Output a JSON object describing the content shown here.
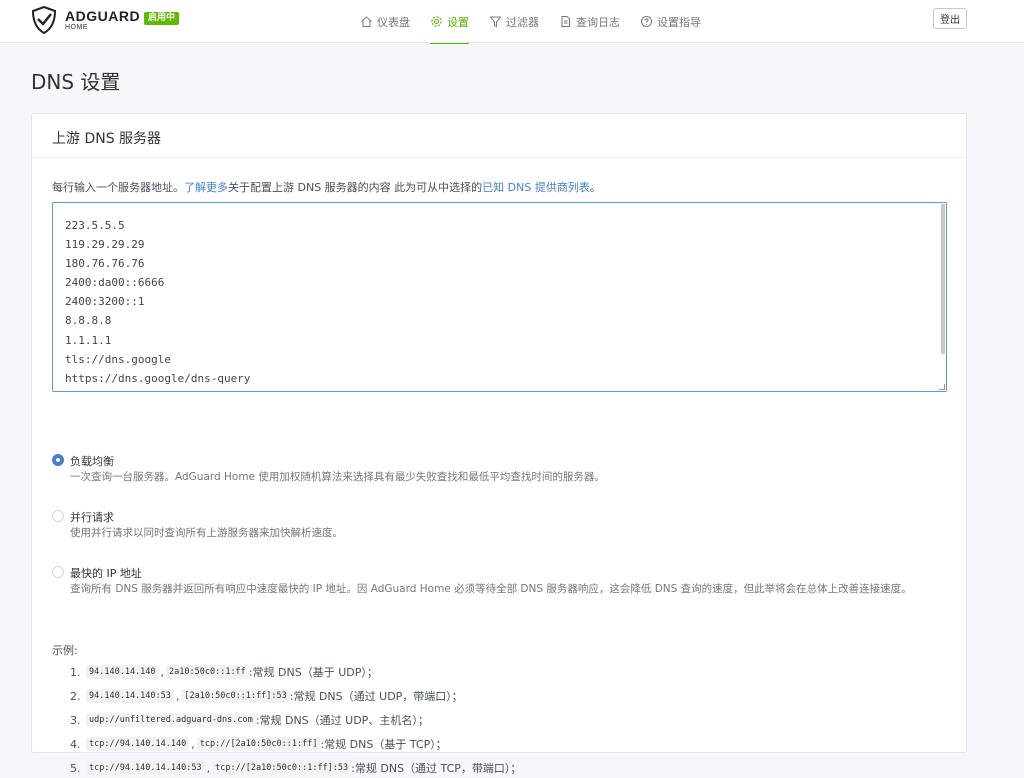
{
  "header": {
    "logo_main": "ADGUARD",
    "logo_sub": "HOME",
    "status_badge": "启用中",
    "nav": [
      {
        "label": "仪表盘",
        "icon": "home-icon"
      },
      {
        "label": "设置",
        "icon": "gear-icon",
        "active": true
      },
      {
        "label": "过滤器",
        "icon": "filter-icon"
      },
      {
        "label": "查询日志",
        "icon": "document-icon"
      },
      {
        "label": "设置指导",
        "icon": "help-circle-icon"
      }
    ],
    "logout_label": "登出",
    "accent_color": "#5eba00"
  },
  "page": {
    "title": "DNS 设置"
  },
  "upstream": {
    "card_title": "上游 DNS 服务器",
    "desc_prefix": "每行输入一个服务器地址。",
    "desc_link1": "了解更多",
    "desc_middle": "关于配置上游 DNS 服务器的内容 此为可从中选择的",
    "desc_link2": "已知 DNS 提供商列表",
    "desc_suffix": "。",
    "servers": [
      "223.5.5.5",
      "119.29.29.29",
      "180.76.76.76",
      "2400:da00::6666",
      "2400:3200::1",
      "8.8.8.8",
      "1.1.1.1",
      "tls://dns.google",
      "https://dns.google/dns-query"
    ],
    "modes": [
      {
        "label": "负载均衡",
        "help": "一次查询一台服务器。AdGuard Home 使用加权随机算法来选择具有最少失败查找和最低平均查找时间的服务器。",
        "checked": true
      },
      {
        "label": "并行请求",
        "help": "使用并行请求以同时查询所有上游服务器来加快解析速度。",
        "checked": false
      },
      {
        "label": "最快的 IP 地址",
        "help": "查询所有 DNS 服务器并返回所有响应中速度最快的 IP 地址。因 AdGuard Home 必须等待全部 DNS 服务器响应，这会降低 DNS 查询的速度，但此举将会在总体上改善连接速度。",
        "checked": false
      }
    ],
    "examples_title": "示例:",
    "examples": [
      {
        "num": "1.",
        "codes": [
          "94.140.14.140",
          "2a10:50c0::1:ff"
        ],
        "text": "常规 DNS（基于 UDP）；"
      },
      {
        "num": "2.",
        "codes": [
          "94.140.14.140:53",
          "[2a10:50c0::1:ff]:53"
        ],
        "text": "常规 DNS（通过 UDP，带端口）；"
      },
      {
        "num": "3.",
        "codes": [
          "udp://unfiltered.adguard-dns.com"
        ],
        "text": "常规 DNS（通过 UDP、主机名）；"
      },
      {
        "num": "4.",
        "codes": [
          "tcp://94.140.14.140",
          "tcp://[2a10:50c0::1:ff]"
        ],
        "text": "常规 DNS（基于 TCP）；"
      },
      {
        "num": "5.",
        "codes": [
          "tcp://94.140.14.140:53",
          "tcp://[2a10:50c0::1:ff]:53"
        ],
        "text": "常规 DNS（通过 TCP，带端口）；"
      }
    ]
  }
}
